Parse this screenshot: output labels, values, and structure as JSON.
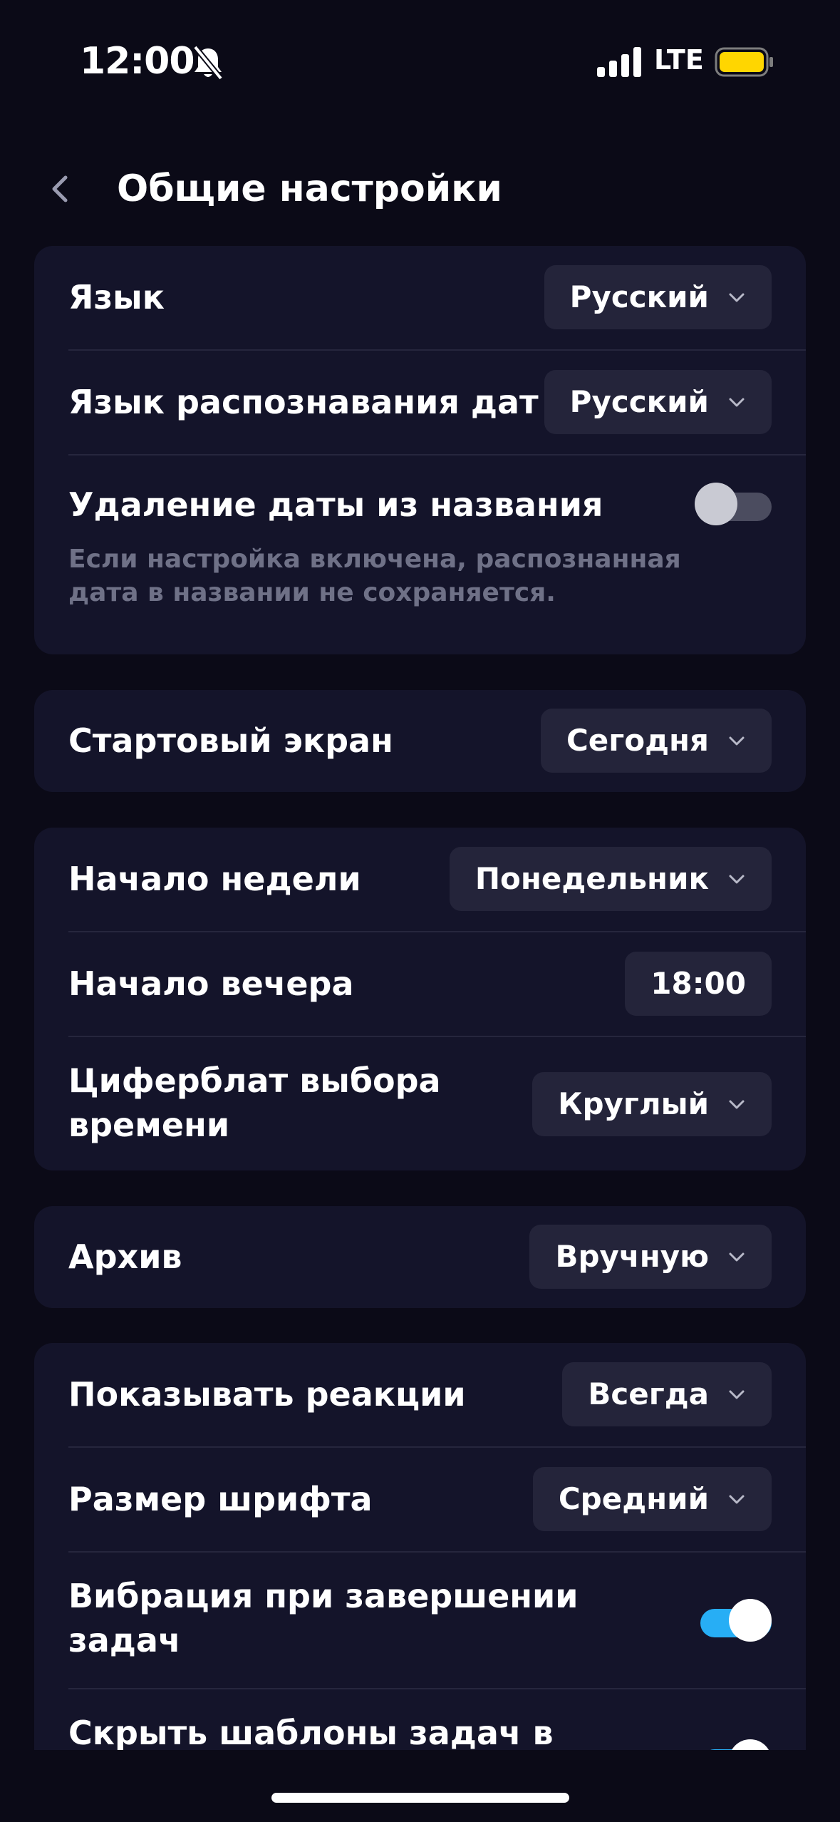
{
  "status_bar": {
    "time": "12:00",
    "network": "LTE",
    "icons": [
      "bell-off-icon",
      "signal-icon",
      "battery-icon"
    ],
    "battery_color": "#ffd600"
  },
  "header": {
    "title": "Общие настройки",
    "back_icon": "chevron-left-icon"
  },
  "colors": {
    "background": "#0b0a17",
    "card": "#14142a",
    "control": "#24243a",
    "accent": "#27aef5",
    "hint": "#6f7187"
  },
  "sections": {
    "language": {
      "language_label": "Язык",
      "language_value": "Русский",
      "date_recognition_label": "Язык распознавания дат",
      "date_recognition_value": "Русский",
      "remove_date_label": "Удаление даты из названия",
      "remove_date_enabled": false,
      "remove_date_hint": "Если настройка включена, распознанная дата в названии не сохраняется."
    },
    "start": {
      "label": "Стартовый экран",
      "value": "Сегодня"
    },
    "time": {
      "week_start_label": "Начало недели",
      "week_start_value": "Понедельник",
      "evening_start_label": "Начало вечера",
      "evening_start_value": "18:00",
      "clock_picker_label": "Циферблат выбора времени",
      "clock_picker_value": "Круглый"
    },
    "archive": {
      "label": "Архив",
      "value": "Вручную"
    },
    "display": {
      "reactions_label": "Показывать реакции",
      "reactions_value": "Всегда",
      "font_size_label": "Размер шрифта",
      "font_size_value": "Средний",
      "vibration_label": "Вибрация при завершении задач",
      "vibration_enabled": true,
      "hide_templates_label": "Скрыть шаблоны задач в",
      "hide_templates_enabled": true
    }
  }
}
